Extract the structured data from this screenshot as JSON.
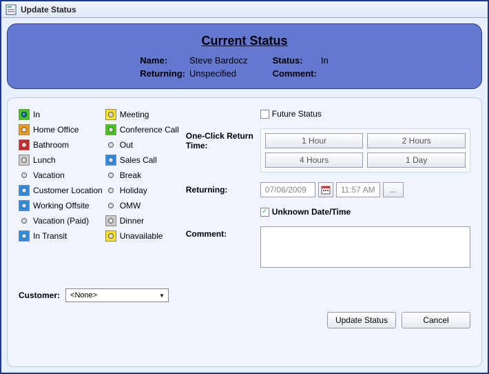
{
  "window": {
    "title": "Update Status"
  },
  "current_status": {
    "heading": "Current Status",
    "name_label": "Name:",
    "name_value": "Steve Bardocz",
    "status_label": "Status:",
    "status_value": "In",
    "returning_label": "Returning:",
    "returning_value": "Unspecified",
    "comment_label": "Comment:",
    "comment_value": ""
  },
  "statuses": {
    "col1": [
      {
        "label": "In",
        "color": "#3bd000",
        "selected": true
      },
      {
        "label": "Home Office",
        "color": "#ff9900",
        "selected": false
      },
      {
        "label": "Bathroom",
        "color": "#e02020",
        "selected": false
      },
      {
        "label": "Lunch",
        "color": "#cccccc",
        "selected": false
      },
      {
        "label": "Vacation",
        "color": "transparent",
        "selected": false
      },
      {
        "label": "Customer Location",
        "color": "#1e90ff",
        "selected": false
      },
      {
        "label": "Working Offsite",
        "color": "#1e90ff",
        "selected": false
      },
      {
        "label": "Vacation (Paid)",
        "color": "transparent",
        "selected": false
      },
      {
        "label": "In Transit",
        "color": "#1e90ff",
        "selected": false
      }
    ],
    "col2": [
      {
        "label": "Meeting",
        "color": "#ffe600",
        "selected": false
      },
      {
        "label": "Conference Call",
        "color": "#3bd000",
        "selected": false
      },
      {
        "label": "Out",
        "color": "transparent",
        "selected": false
      },
      {
        "label": "Sales Call",
        "color": "#1e90ff",
        "selected": false
      },
      {
        "label": "Break",
        "color": "transparent",
        "selected": false
      },
      {
        "label": "Holiday",
        "color": "transparent",
        "selected": false
      },
      {
        "label": "OMW",
        "color": "transparent",
        "selected": false
      },
      {
        "label": "Dinner",
        "color": "#cccccc",
        "selected": false
      },
      {
        "label": "Unavailable",
        "color": "#ffe600",
        "selected": false
      }
    ]
  },
  "right": {
    "future_status_label": "Future Status",
    "future_status_checked": false,
    "one_click_label": "One-Click Return Time:",
    "quick_buttons": [
      "1 Hour",
      "2 Hours",
      "4 Hours",
      "1 Day"
    ],
    "returning_label": "Returning:",
    "returning_date": "07/06/2009",
    "returning_time": "11:57 AM",
    "more_btn": "...",
    "unknown_label": "Unknown Date/Time",
    "unknown_checked": true,
    "comment_label": "Comment:",
    "comment_value": ""
  },
  "customer": {
    "label": "Customer:",
    "selected": "<None>"
  },
  "footer": {
    "update": "Update Status",
    "cancel": "Cancel"
  }
}
